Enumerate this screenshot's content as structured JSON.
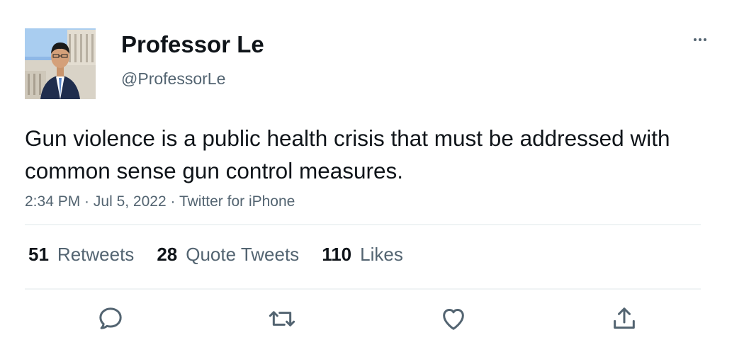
{
  "tweet": {
    "display_name": "Professor Le",
    "handle": "@ProfessorLe",
    "text": "Gun violence is a public health crisis that must be addressed with common sense gun control measures.",
    "time": "2:34 PM",
    "separator": " · ",
    "date": "Jul 5, 2022",
    "source": "Twitter for iPhone"
  },
  "stats": {
    "retweets_count": "51",
    "retweets_label": "Retweets",
    "quotes_count": "28",
    "quotes_label": "Quote Tweets",
    "likes_count": "110",
    "likes_label": "Likes"
  },
  "icons": {
    "more": "more-icon",
    "reply": "reply-icon",
    "retweet": "retweet-icon",
    "like": "like-icon",
    "share": "share-icon"
  },
  "colors": {
    "text_primary": "#0f1419",
    "text_secondary": "#536471",
    "divider": "#eff3f4"
  }
}
